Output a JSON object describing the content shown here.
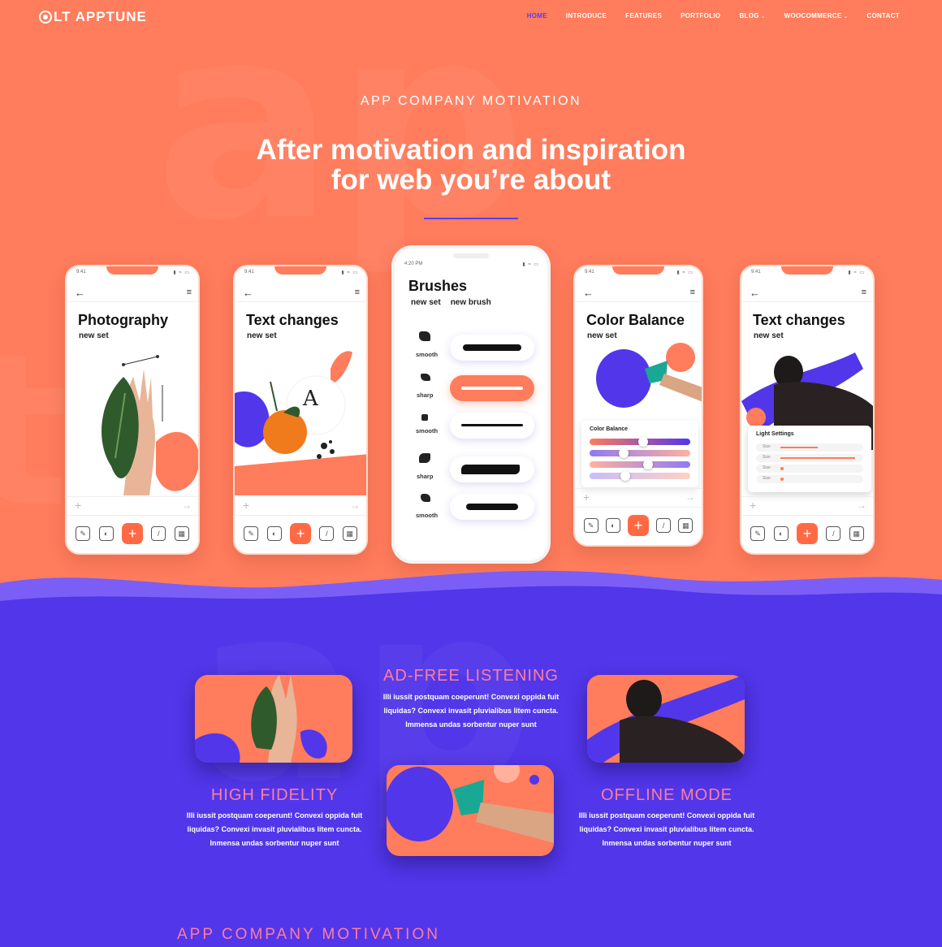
{
  "brand": {
    "name": "LT APPTUNE"
  },
  "nav": {
    "items": [
      {
        "label": "HOME",
        "active": true
      },
      {
        "label": "INTRODUCE"
      },
      {
        "label": "FEATURES"
      },
      {
        "label": "PORTFOLIO"
      },
      {
        "label": "BLOG",
        "dropdown": true
      },
      {
        "label": "WOOCOMMERCE",
        "dropdown": true
      },
      {
        "label": "CONTACT"
      }
    ]
  },
  "hero": {
    "eyebrow": "APP COMPANY MOTIVATION",
    "headline_line1": "After motivation and inspiration",
    "headline_line2": "for web you’re about"
  },
  "phones": [
    {
      "time": "9:41",
      "title": "Photography",
      "subtitle": "new set"
    },
    {
      "time": "9:41",
      "title": "Text changes",
      "subtitle": "new set"
    },
    {
      "time": "4:20 PM",
      "title": "Brushes",
      "tabs": [
        "new set",
        "new brush"
      ],
      "brushes": [
        {
          "label": "smooth"
        },
        {
          "label": "sharp"
        },
        {
          "label": "smooth"
        },
        {
          "label": "sharp"
        },
        {
          "label": "smooth"
        }
      ]
    },
    {
      "time": "9:41",
      "title": "Color Balance",
      "subtitle": "new set",
      "panel_title": "Color Balance"
    },
    {
      "time": "9:41",
      "title": "Text changes",
      "subtitle": "new set",
      "panel_title": "Light Settings",
      "rows": [
        "Size",
        "Size",
        "Size",
        "Size"
      ]
    }
  ],
  "phone_art_text": "A",
  "features": [
    {
      "title": "AD-FREE LISTENING",
      "text": "Illi iussit postquam coeperunt! Convexi oppida fuit liquidas? Convexi invasit pluvialibus litem cuncta. Immensa undas sorbentur nuper sunt"
    },
    {
      "title": "HIGH FIDELITY",
      "text": "Illi iussit postquam coeperunt! Convexi oppida fuit liquidas? Convexi invasit pluvialibus litem cuncta. Inmensa undas sorbentur nuper sunt"
    },
    {
      "title": "OFFLINE MODE",
      "text": "Illi iussit postquam coeperunt! Convexi oppida fuit liquidas? Convexi invasit pluvialibus litem cuncta. Inmensa undas sorbentur nuper sunt"
    }
  ],
  "footer": {
    "eyebrow": "APP COMPANY MOTIVATION"
  },
  "colors": {
    "coral": "#ff7c5c",
    "violet": "#5236ea",
    "pink": "#ff7e9c",
    "accent": "#5b3cf0"
  }
}
